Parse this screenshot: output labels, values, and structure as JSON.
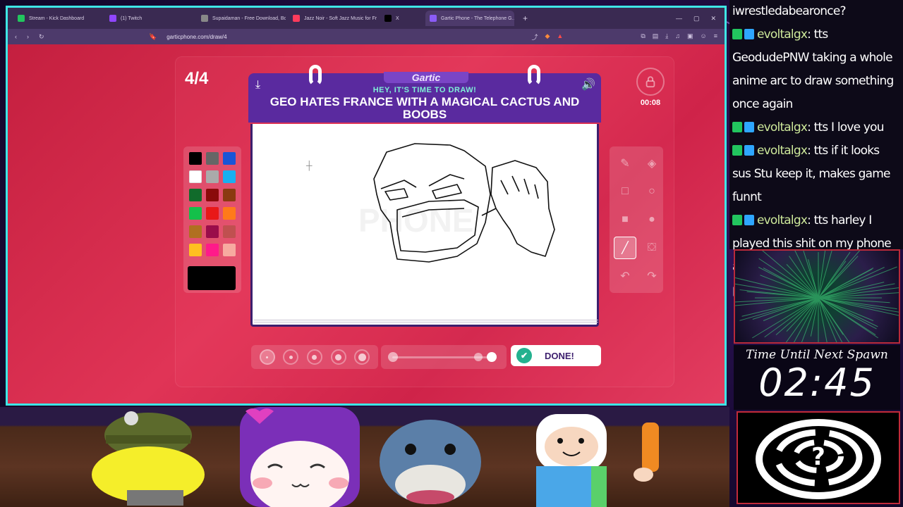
{
  "browser": {
    "tabs": [
      {
        "label": "Stream - Kick Dashboard",
        "color": "#22c55e",
        "active": false
      },
      {
        "label": "(1) Twitch",
        "color": "#9146ff",
        "active": false
      },
      {
        "label": "Supaidaman - Free Download, Borro…",
        "color": "#888888",
        "active": false
      },
      {
        "label": "Jazz Noir - Soft Jazz Music for Fr…",
        "color": "#ff3b5c",
        "active": false
      },
      {
        "label": "X",
        "color": "#000000",
        "active": false
      },
      {
        "label": "Gartic Phone - The Telephone G…",
        "color": "#8b5cf6",
        "active": true
      }
    ],
    "new_tab": "+",
    "url": "garticphone.com/draw/4"
  },
  "game": {
    "round": "4/4",
    "timer": "00:08",
    "brand": "Gartic",
    "subtitle": "HEY, IT'S TIME TO DRAW!",
    "prompt": "GEO HATES FRANCE WITH A MAGICAL CACTUS AND BOOBS",
    "watermark": "PHONE",
    "done_label": "DONE!",
    "palette": [
      "#000000",
      "#666666",
      "#1a55d6",
      "#ffffff",
      "#aaaaaa",
      "#19b0f0",
      "#116b2b",
      "#8a0a0a",
      "#8a3a10",
      "#14c04a",
      "#e81818",
      "#ff7a1a",
      "#b07020",
      "#9a0d4a",
      "#c05050",
      "#ffc020",
      "#ff1a8a",
      "#f7aaa0"
    ],
    "current_color": "#000000",
    "tools": [
      "pencil-icon",
      "eraser-icon",
      "rect-outline-icon",
      "ellipse-outline-icon",
      "rect-fill-icon",
      "ellipse-fill-icon",
      "line-icon",
      "bucket-icon",
      "undo-icon",
      "redo-icon"
    ],
    "selected_tool": "line-icon",
    "brush_sizes": 5,
    "selected_size": 0
  },
  "chat": {
    "messages": [
      {
        "user": "",
        "text": "iwrestledabearonce?"
      },
      {
        "user": "evoltalgx",
        "text": ": tts GeodudePNW taking a whole anime arc to draw something once again"
      },
      {
        "user": "evoltalgx",
        "text": ": tts I love you"
      },
      {
        "user": "evoltalgx",
        "text": ": tts if it looks sus Stu keep it, makes game funnt"
      },
      {
        "user": "evoltalgx",
        "text": ": tts harley I played this shit on my phone and drew the most shit posty pictures 🤣"
      }
    ]
  },
  "overlay": {
    "spawn_label": "Time Until Next Spawn",
    "spawn_time": "02:45"
  }
}
